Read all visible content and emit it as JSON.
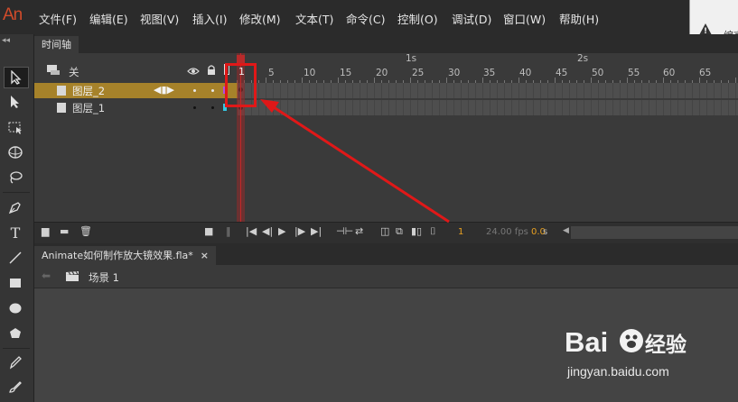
{
  "app": {
    "logo": "An"
  },
  "menu": {
    "items": [
      "文件(F)",
      "编辑(E)",
      "视图(V)",
      "插入(I)",
      "修改(M)",
      "文本(T)",
      "命令(C)",
      "控制(O)",
      "调试(D)",
      "窗口(W)",
      "帮助(H)"
    ]
  },
  "notice": {
    "text": "编言"
  },
  "timeline": {
    "tab_label": "时间轴",
    "layer_header_label": "关",
    "second_markers": [
      "1s",
      "2s"
    ],
    "frame_numbers": [
      "5",
      "10",
      "15",
      "20",
      "25",
      "30",
      "35",
      "40",
      "45",
      "50",
      "55",
      "60",
      "65"
    ],
    "playhead_frame": "1",
    "layers": [
      {
        "name": "图层_2",
        "selected": true
      },
      {
        "name": "图层_1",
        "selected": false
      }
    ],
    "current_frame": "1",
    "fps": "24.00 fps",
    "time_value": "0.0",
    "time_unit": "s"
  },
  "document": {
    "tab_label": "Animate如何制作放大镜效果.fla*",
    "close_symbol": "×"
  },
  "edit_bar": {
    "scene_label": "场景 1"
  },
  "watermark": {
    "text": "jingyan.baidu.com"
  },
  "colors": {
    "accent_selected_layer": "#a6822a",
    "annotation": "#e01818",
    "playhead": "#c32828"
  }
}
